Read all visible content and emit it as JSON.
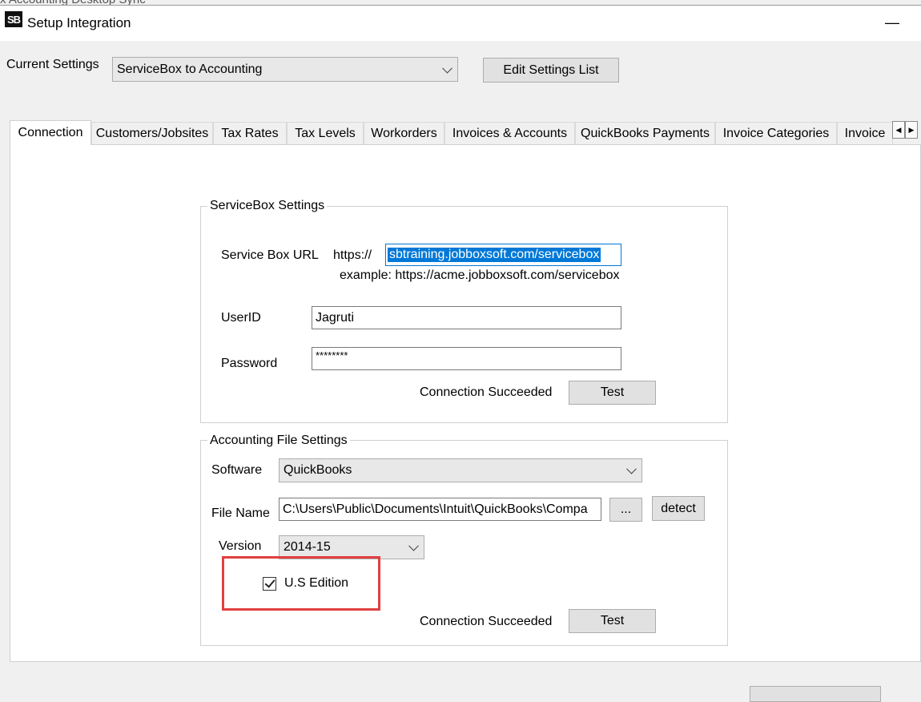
{
  "window": {
    "behind_title": "x Accounting Desktop Sync",
    "app_icon_text": "SB",
    "title": "Setup Integration",
    "minimize": "—"
  },
  "header": {
    "current_settings_label": "Current Settings",
    "current_settings_value": "ServiceBox to Accounting",
    "edit_settings_button": "Edit Settings List"
  },
  "tabs": [
    {
      "label": "Connection",
      "active": true
    },
    {
      "label": "Customers/Jobsites"
    },
    {
      "label": "Tax Rates"
    },
    {
      "label": "Tax Levels"
    },
    {
      "label": "Workorders"
    },
    {
      "label": "Invoices & Accounts"
    },
    {
      "label": "QuickBooks Payments"
    },
    {
      "label": "Invoice Categories"
    },
    {
      "label": "Invoice"
    }
  ],
  "tab_scroll": {
    "left": "◀",
    "right": "▶"
  },
  "servicebox": {
    "legend": "ServiceBox Settings",
    "url_label": "Service Box URL",
    "url_prefix": "https://",
    "url_value": "sbtraining.jobboxsoft.com/servicebox",
    "url_example": "example: https://acme.jobboxsoft.com/servicebox",
    "userid_label": "UserID",
    "userid_value": "Jagruti",
    "password_label": "Password",
    "password_value": "********",
    "status": "Connection Succeeded",
    "test_button": "Test"
  },
  "accounting": {
    "legend": "Accounting File Settings",
    "software_label": "Software",
    "software_value": "QuickBooks",
    "filename_label": "File Name",
    "filename_value": "C:\\Users\\Public\\Documents\\Intuit\\QuickBooks\\Compa",
    "browse_button": "...",
    "detect_button": "detect",
    "version_label": "Version",
    "version_value": "2014-15",
    "us_edition_label": "U.S Edition",
    "us_edition_checked": true,
    "status": "Connection Succeeded",
    "test_button": "Test"
  },
  "colors": {
    "selection": "#0078d7",
    "highlight_box": "#e04040"
  }
}
